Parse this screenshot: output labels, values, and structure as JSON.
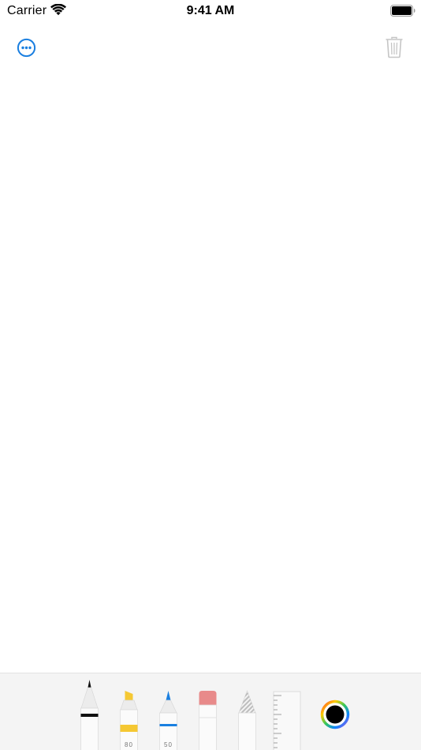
{
  "status_bar": {
    "carrier": "Carrier",
    "time": "9:41 AM",
    "wifi_icon": "wifi-icon",
    "battery_icon": "battery-full-icon"
  },
  "toolbar": {
    "more_icon": "ellipsis-circle-icon",
    "trash_icon": "trash-icon",
    "accent_color": "#1a7fe0",
    "disabled_color": "#c5c5c5"
  },
  "tool_picker": {
    "tools": [
      {
        "name": "pen",
        "icon": "pen-icon",
        "color": "#111111",
        "label": ""
      },
      {
        "name": "marker",
        "icon": "marker-icon",
        "color": "#f5c833",
        "label": "80"
      },
      {
        "name": "pencil",
        "icon": "pencil-icon",
        "color": "#1a7fe0",
        "label": "50"
      },
      {
        "name": "eraser",
        "icon": "eraser-icon",
        "color": "#e88a8a",
        "label": ""
      },
      {
        "name": "lasso",
        "icon": "lasso-icon",
        "color": "#bdbdbd",
        "label": ""
      },
      {
        "name": "ruler",
        "icon": "ruler-icon",
        "color": "#9a9a9a",
        "label": ""
      }
    ],
    "selected_color": "#000000",
    "color_picker_icon": "color-wheel-icon"
  }
}
